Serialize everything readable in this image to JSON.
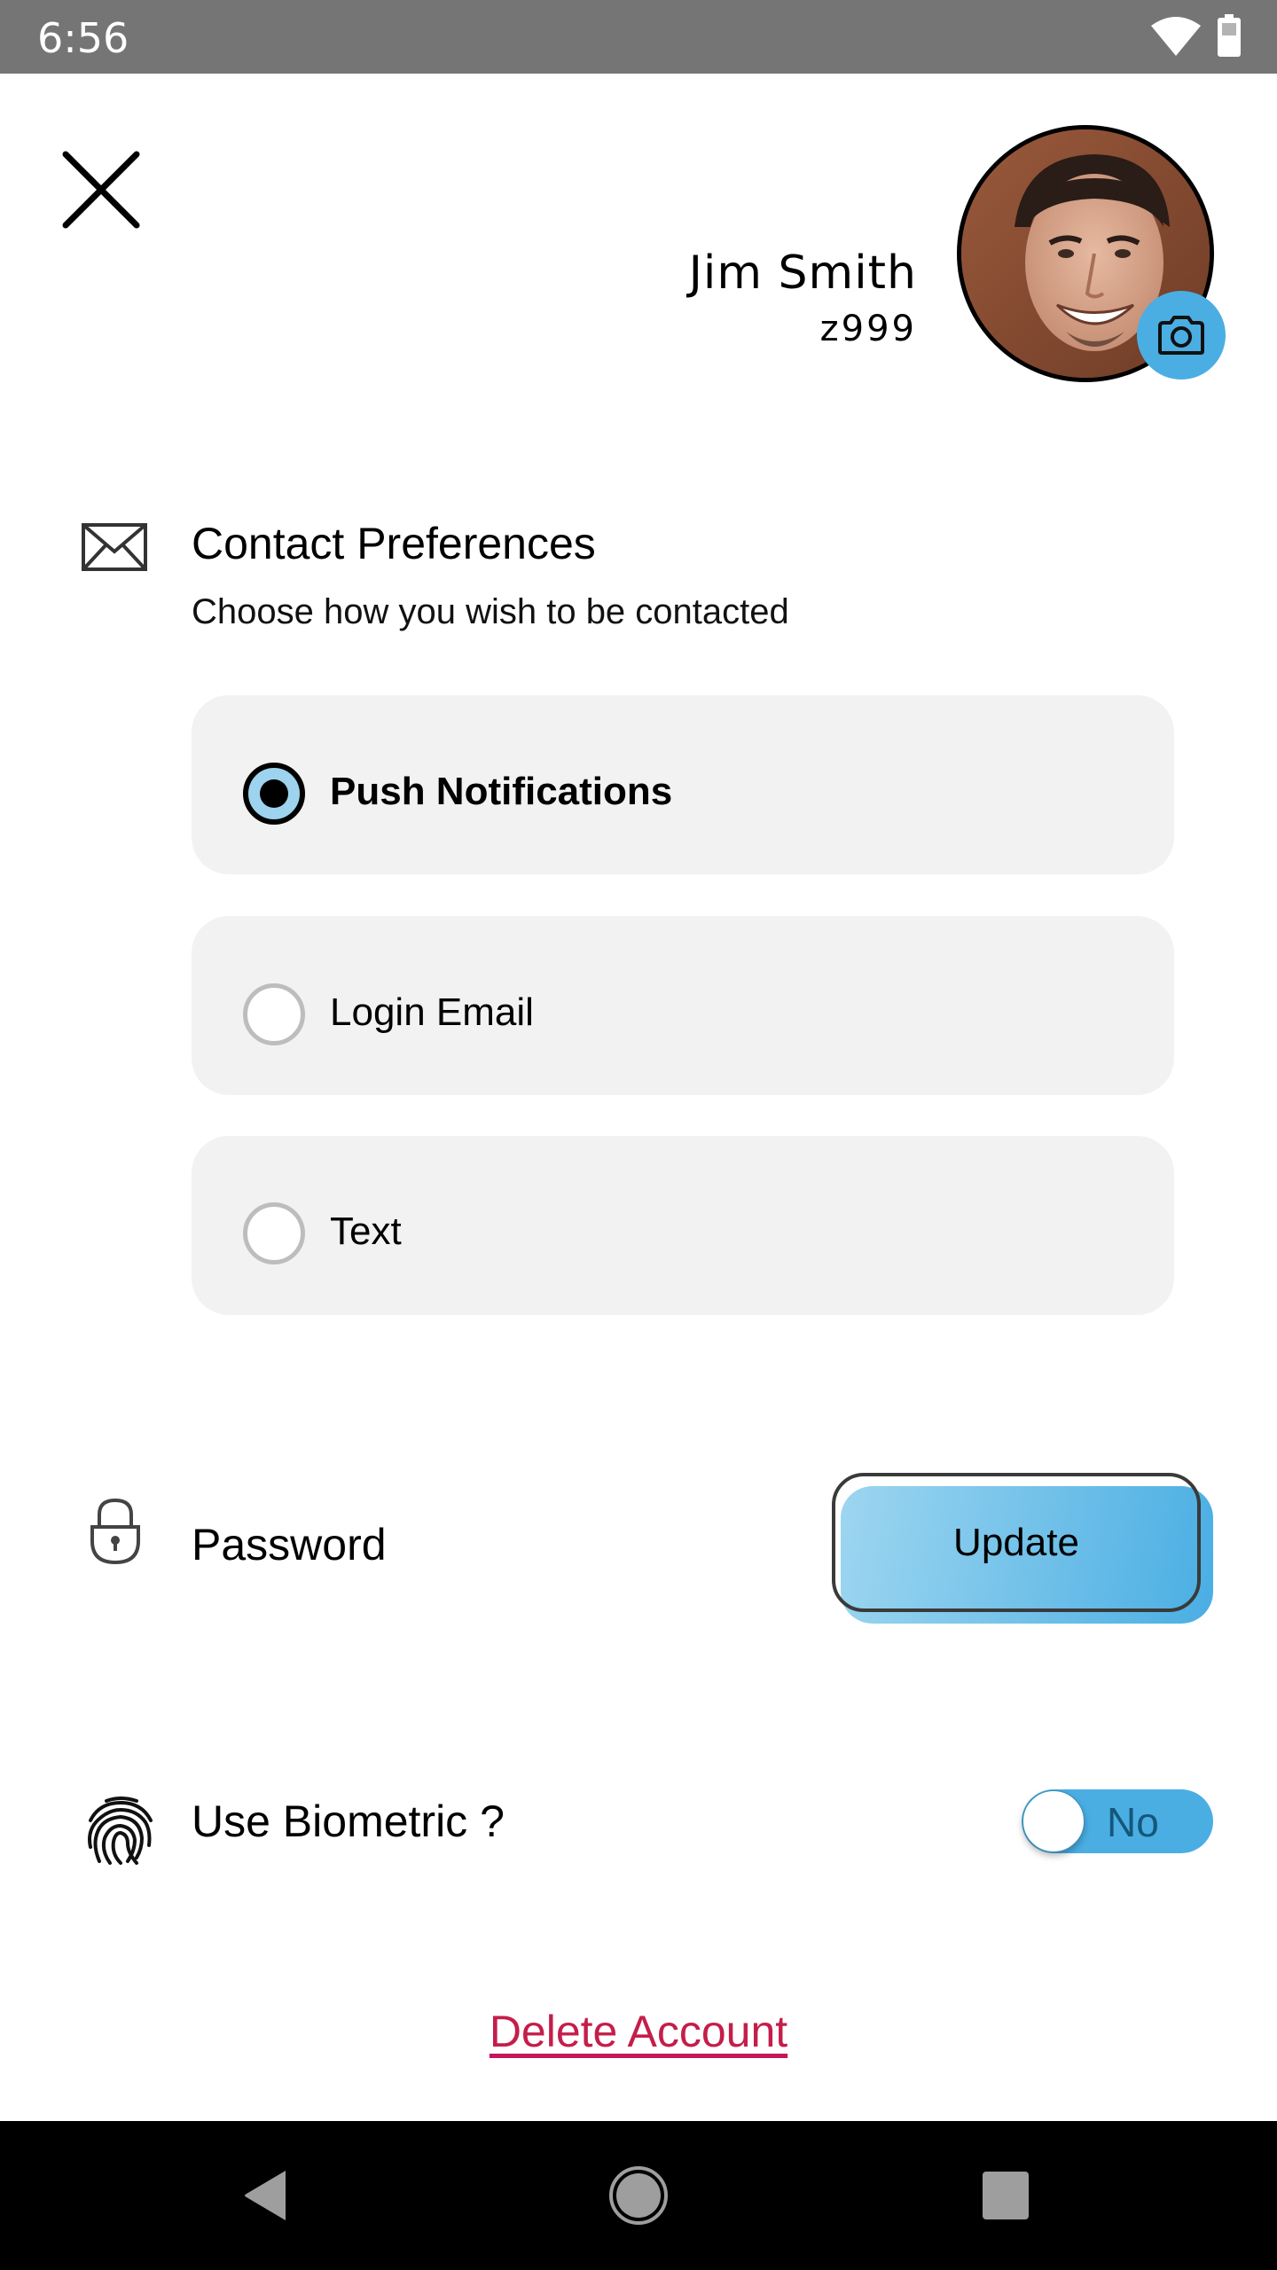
{
  "status_bar": {
    "time": "6:56",
    "icons": [
      "wifi-icon",
      "battery-icon"
    ]
  },
  "header": {
    "close_icon": "close-icon",
    "profile": {
      "name": "Jim Smith",
      "user_id": "z999",
      "avatar_icon": "avatar-photo",
      "camera_icon": "camera-icon"
    }
  },
  "contact_preferences": {
    "icon": "mail-icon",
    "title": "Contact Preferences",
    "subtitle": "Choose how you wish to be contacted",
    "options": [
      {
        "label": "Push Notifications",
        "selected": true
      },
      {
        "label": "Login Email",
        "selected": false
      },
      {
        "label": "Text",
        "selected": false
      }
    ]
  },
  "password": {
    "icon": "lock-icon",
    "label": "Password",
    "button_label": "Update"
  },
  "biometric": {
    "icon": "fingerprint-icon",
    "label": "Use Biometric ?",
    "toggle_value": "No",
    "enabled": false
  },
  "delete_account": {
    "label": "Delete Account"
  },
  "nav_bar": {
    "buttons": [
      "back-icon",
      "home-icon",
      "recents-icon"
    ]
  },
  "colors": {
    "accent": "#4AAEE3",
    "danger": "#C41E4A",
    "card_bg": "#F2F2F2",
    "status_bar": "#757575"
  }
}
